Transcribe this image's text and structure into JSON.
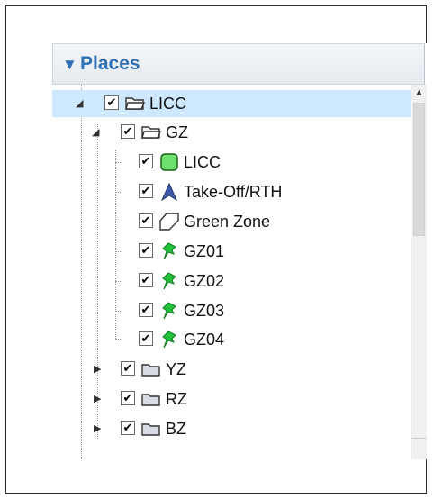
{
  "panel": {
    "title": "Places",
    "collapse_icon": "triangle-down-icon"
  },
  "tree": {
    "root": {
      "label": "LICC",
      "checked": true,
      "expanded": true,
      "icon": "open-folder-icon"
    },
    "group_gz": {
      "label": "GZ",
      "checked": true,
      "expanded": true,
      "icon": "open-folder-icon"
    },
    "gz_items": [
      {
        "label": "LICC",
        "checked": true,
        "icon": "green-polygon-icon"
      },
      {
        "label": "Take-Off/RTH",
        "checked": true,
        "icon": "navigation-arrow-icon"
      },
      {
        "label": "Green Zone",
        "checked": true,
        "icon": "polygon-outline-icon"
      },
      {
        "label": "GZ01",
        "checked": true,
        "icon": "green-pushpin-icon"
      },
      {
        "label": "GZ02",
        "checked": true,
        "icon": "green-pushpin-icon"
      },
      {
        "label": "GZ03",
        "checked": true,
        "icon": "green-pushpin-icon"
      },
      {
        "label": "GZ04",
        "checked": true,
        "icon": "green-pushpin-icon"
      }
    ],
    "collapsed_groups": [
      {
        "label": "YZ",
        "checked": true,
        "icon": "closed-folder-icon"
      },
      {
        "label": "RZ",
        "checked": true,
        "icon": "closed-folder-icon"
      },
      {
        "label": "BZ",
        "checked": true,
        "icon": "closed-folder-icon"
      }
    ]
  },
  "colors": {
    "header_text": "#2f6fb3",
    "selection": "#cde8ff",
    "pin_green": "#22c33a",
    "polygon_green": "#6ee06e"
  }
}
